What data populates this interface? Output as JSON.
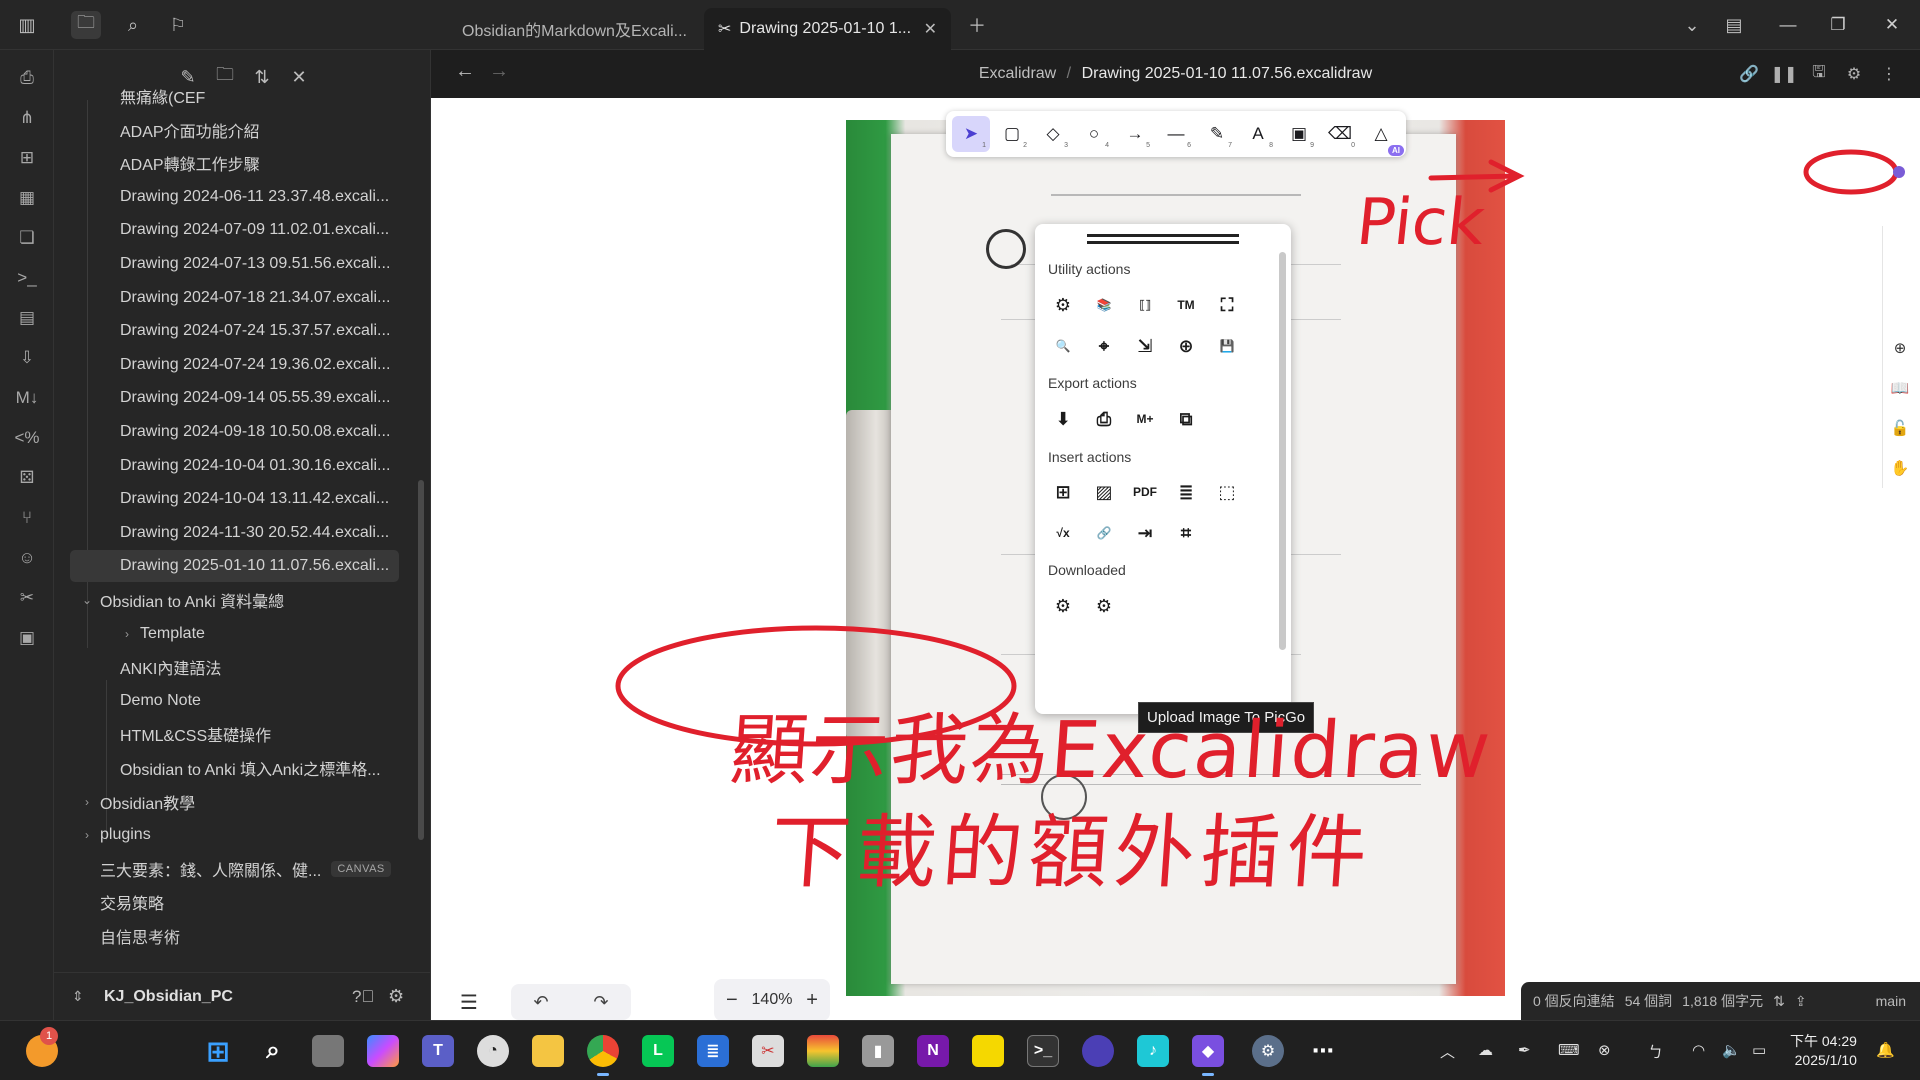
{
  "tabs": [
    {
      "label": "Obsidian的Markdown及Excali...",
      "active": false
    },
    {
      "label": "Drawing 2025-01-10 1...",
      "active": true
    }
  ],
  "explorer": {
    "items": [
      {
        "label": "無痛緣(CEF",
        "indent": 2,
        "folder": false
      },
      {
        "label": "ADAP介面功能介紹",
        "indent": 2,
        "folder": false
      },
      {
        "label": "ADAP轉錄工作步驟",
        "indent": 2,
        "folder": false
      },
      {
        "label": "Drawing 2024-06-11 23.37.48.excali...",
        "indent": 2,
        "folder": false
      },
      {
        "label": "Drawing 2024-07-09 11.02.01.excali...",
        "indent": 2,
        "folder": false
      },
      {
        "label": "Drawing 2024-07-13 09.51.56.excali...",
        "indent": 2,
        "folder": false
      },
      {
        "label": "Drawing 2024-07-18 21.34.07.excali...",
        "indent": 2,
        "folder": false
      },
      {
        "label": "Drawing 2024-07-24 15.37.57.excali...",
        "indent": 2,
        "folder": false
      },
      {
        "label": "Drawing 2024-07-24 19.36.02.excali...",
        "indent": 2,
        "folder": false
      },
      {
        "label": "Drawing 2024-09-14 05.55.39.excali...",
        "indent": 2,
        "folder": false
      },
      {
        "label": "Drawing 2024-09-18 10.50.08.excali...",
        "indent": 2,
        "folder": false
      },
      {
        "label": "Drawing 2024-10-04 01.30.16.excali...",
        "indent": 2,
        "folder": false
      },
      {
        "label": "Drawing 2024-10-04 13.11.42.excali...",
        "indent": 2,
        "folder": false
      },
      {
        "label": "Drawing 2024-11-30 20.52.44.excali...",
        "indent": 2,
        "folder": false
      },
      {
        "label": "Drawing 2025-01-10 11.07.56.excali...",
        "indent": 2,
        "folder": false,
        "selected": true
      },
      {
        "label": "Obsidian to Anki 資料彙總",
        "indent": 1,
        "folder": true,
        "open": true
      },
      {
        "label": "Template",
        "indent": 2,
        "folder": true,
        "open": false
      },
      {
        "label": "ANKI內建語法",
        "indent": 2,
        "folder": false
      },
      {
        "label": "Demo Note",
        "indent": 2,
        "folder": false
      },
      {
        "label": "HTML&CSS基礎操作",
        "indent": 2,
        "folder": false
      },
      {
        "label": "Obsidian to Anki 填入Anki之標準格...",
        "indent": 2,
        "folder": false
      },
      {
        "label": "Obsidian教學",
        "indent": 1,
        "folder": true,
        "open": false
      },
      {
        "label": "plugins",
        "indent": 1,
        "folder": true,
        "open": false
      },
      {
        "label": "三大要素：錢、人際關係、健...",
        "indent": 1,
        "folder": false,
        "tag": "CANVAS"
      },
      {
        "label": "交易策略",
        "indent": 1,
        "folder": false
      },
      {
        "label": "自信思考術",
        "indent": 1,
        "folder": false
      }
    ],
    "vault_name": "KJ_Obsidian_PC"
  },
  "view": {
    "breadcrumb_folder": "Excalidraw",
    "breadcrumb_sep": "/",
    "breadcrumb_file": "Drawing 2025-01-10 11.07.56.excalidraw"
  },
  "toolbar": {
    "tools": [
      {
        "icon": "pointer-icon",
        "glyph": "➤",
        "num": "1",
        "active": true
      },
      {
        "icon": "rectangle-icon",
        "glyph": "▢",
        "num": "2"
      },
      {
        "icon": "diamond-icon",
        "glyph": "◇",
        "num": "3"
      },
      {
        "icon": "ellipse-icon",
        "glyph": "○",
        "num": "4"
      },
      {
        "icon": "arrow-icon",
        "glyph": "→",
        "num": "5"
      },
      {
        "icon": "line-icon",
        "glyph": "—",
        "num": "6"
      },
      {
        "icon": "pencil-icon",
        "glyph": "✎",
        "num": "7"
      },
      {
        "icon": "text-icon",
        "glyph": "A",
        "num": "8"
      },
      {
        "icon": "image-icon",
        "glyph": "▣",
        "num": "9"
      },
      {
        "icon": "eraser-icon",
        "glyph": "⌫",
        "num": "0"
      },
      {
        "icon": "shapes-library-icon",
        "glyph": "△",
        "num": "",
        "badge": "AI"
      }
    ]
  },
  "script_panel": {
    "sections": {
      "utility": "Utility actions",
      "export": "Export actions",
      "insert": "Insert actions",
      "downloaded": "Downloaded"
    },
    "utility_row1": [
      {
        "icon": "settings-icon",
        "glyph": "⚙"
      },
      {
        "icon": "library-icon",
        "glyph": "📚"
      },
      {
        "icon": "embed-icon",
        "glyph": "⟦⟧"
      },
      {
        "icon": "trademark-icon",
        "glyph": "TM"
      },
      {
        "icon": "fullscreen-icon",
        "glyph": "⛶"
      }
    ],
    "utility_row2": [
      {
        "icon": "search-icon",
        "glyph": "🔍"
      },
      {
        "icon": "ocr-icon",
        "glyph": "⌖"
      },
      {
        "icon": "open-file-icon",
        "glyph": "⇲"
      },
      {
        "icon": "new-file-icon",
        "glyph": "⊕"
      },
      {
        "icon": "save-icon",
        "glyph": "💾"
      }
    ],
    "export_row": [
      {
        "icon": "export-image-icon",
        "glyph": "⬇"
      },
      {
        "icon": "export-picture-icon",
        "glyph": "⎙"
      },
      {
        "icon": "markdown-icon",
        "glyph": "M+"
      },
      {
        "icon": "export-embed-icon",
        "glyph": "⧉"
      }
    ],
    "insert_row1": [
      {
        "icon": "insert-file-icon",
        "glyph": "⊞"
      },
      {
        "icon": "insert-image-icon",
        "glyph": "▨"
      },
      {
        "icon": "insert-pdf-icon",
        "glyph": "PDF"
      },
      {
        "icon": "insert-doc-icon",
        "glyph": "≣"
      },
      {
        "icon": "insert-card-icon",
        "glyph": "⬚"
      }
    ],
    "insert_row2": [
      {
        "icon": "latex-icon",
        "glyph": "√x"
      },
      {
        "icon": "link-icon",
        "glyph": "🔗"
      },
      {
        "icon": "import-icon",
        "glyph": "⇥"
      },
      {
        "icon": "crop-icon",
        "glyph": "⌗"
      }
    ],
    "downloaded_row": [
      {
        "icon": "script-gear-icon",
        "glyph": "⚙"
      },
      {
        "icon": "script-gear-2-icon",
        "glyph": "⚙"
      }
    ],
    "tooltip": "Upload Image To PicGo"
  },
  "zoom": {
    "level": "140%"
  },
  "annotations": {
    "pick": "Pick",
    "line1": "顯示我為Excalidraw",
    "line2": "下載的額外插件"
  },
  "statusbar": {
    "backlinks": "0 個反向連結",
    "words": "54 個詞",
    "chars": "1,818 個字元",
    "branch": "main"
  },
  "taskbar": {
    "notification_count": "1",
    "clock_time": "下午 04:29",
    "clock_date": "2025/1/10"
  },
  "colors": {
    "annotation_red": "#e0202c",
    "accent_purple": "#6e5bd6",
    "tool_active_bg": "#d8d6fb"
  }
}
